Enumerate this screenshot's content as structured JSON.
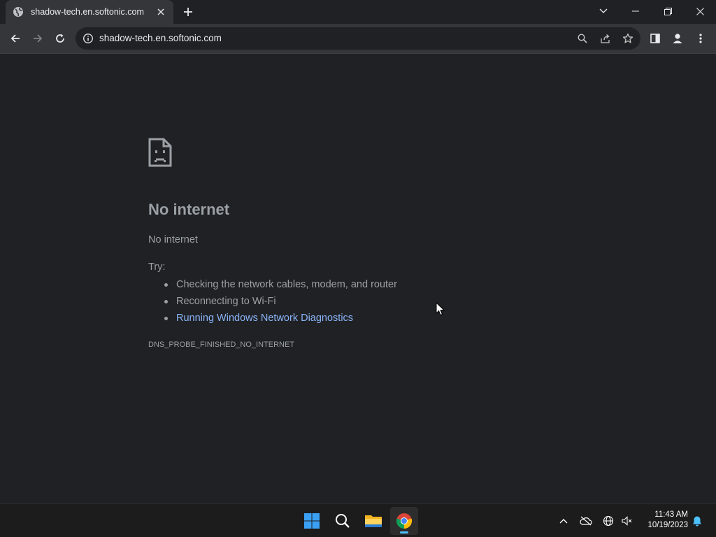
{
  "browser": {
    "tab": {
      "title": "shadow-tech.en.softonic.com",
      "favicon": "globe-icon"
    },
    "omnibox": {
      "url": "shadow-tech.en.softonic.com"
    },
    "colors": {
      "tab_bg": "#35363a",
      "frame_bg": "#202124",
      "link": "#8ab4f8",
      "text": "#9aa0a6"
    }
  },
  "error_page": {
    "heading": "No internet",
    "subheading": "No internet",
    "try_label": "Try:",
    "suggestions": [
      "Checking the network cables, modem, and router",
      "Reconnecting to Wi-Fi",
      "Running Windows Network Diagnostics"
    ],
    "error_code": "DNS_PROBE_FINISHED_NO_INTERNET"
  },
  "taskbar": {
    "apps": [
      "start-icon",
      "search-icon",
      "file-explorer-icon",
      "chrome-icon"
    ],
    "clock": {
      "time": "11:43 AM",
      "date": "10/19/2023"
    }
  }
}
